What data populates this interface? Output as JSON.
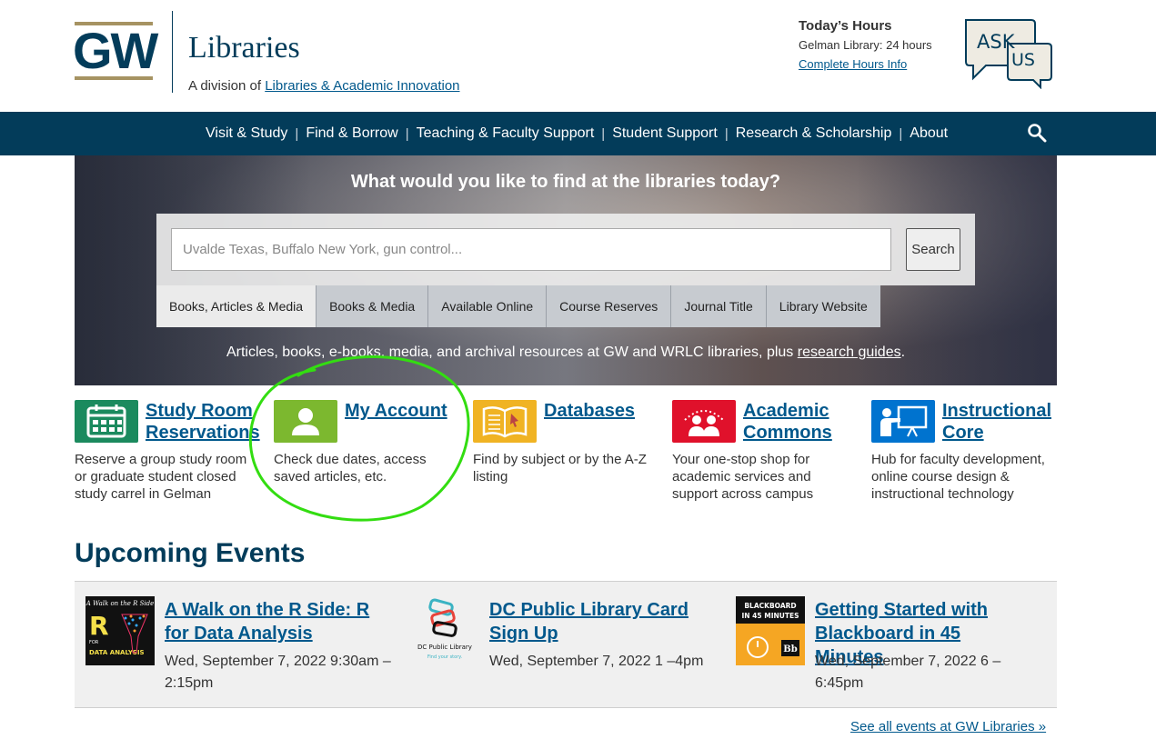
{
  "header": {
    "logo_text": "GW",
    "title": "Libraries",
    "division_prefix": "A division of",
    "division_link": "Libraries & Academic Innovation",
    "hours_title": "Today’s Hours",
    "hours_line": "Gelman Library: 24 hours",
    "hours_link": "Complete Hours Info",
    "ask_us": {
      "line1": "ASK",
      "line2": "US"
    }
  },
  "nav": {
    "items": [
      {
        "label": "Visit & Study"
      },
      {
        "label": "Find & Borrow"
      },
      {
        "label": "Teaching & Faculty Support"
      },
      {
        "label": "Student Support"
      },
      {
        "label": "Research & Scholarship"
      },
      {
        "label": "About"
      }
    ],
    "separator": "|",
    "search_icon": "search-icon"
  },
  "hero": {
    "question": "What would you like to find at the libraries today?",
    "search_placeholder": "Uvalde Texas, Buffalo New York, gun control...",
    "search_button": "Search",
    "tabs": [
      {
        "label": "Books, Articles & Media",
        "active": true
      },
      {
        "label": "Books & Media"
      },
      {
        "label": "Available Online"
      },
      {
        "label": "Course Reserves"
      },
      {
        "label": "Journal Title"
      },
      {
        "label": "Library Website"
      }
    ],
    "description_prefix": "Articles, books, e-books, media, and archival resources at GW and WRLC libraries, plus",
    "description_link": "research guides",
    "description_suffix": "."
  },
  "quick_links": [
    {
      "title": "Study Room Reservations",
      "desc": "Reserve a group study room or graduate student closed study carrel in Gelman",
      "icon": "calendar-icon",
      "color": "#1b8a5e"
    },
    {
      "title": "My Account",
      "desc": "Check due dates, access saved articles, etc.",
      "icon": "user-icon",
      "color": "#7cb82f"
    },
    {
      "title": "Databases",
      "desc": "Find by subject or by the A-Z listing",
      "icon": "book-icon",
      "color": "#f0b323"
    },
    {
      "title": "Academic Commons",
      "desc": "Your one-stop shop for academic services and support across campus",
      "icon": "group-icon",
      "color": "#e0112b"
    },
    {
      "title": "Instructional Core",
      "desc": "Hub for faculty development, online course design & instructional technology",
      "icon": "presenter-icon",
      "color": "#0073cf"
    }
  ],
  "events": {
    "title": "Upcoming Events",
    "items": [
      {
        "title": "A Walk on the R Side: R for Data Analysis",
        "date": "Wed, September 7, 2022 9:30am –2:15pm",
        "thumb_top": "A Walk on the R Side",
        "thumb_letter": "R",
        "thumb_for": "FOR",
        "thumb_sub": "DATA ANALYSIS"
      },
      {
        "title": "DC Public Library Card Sign Up",
        "date": "Wed, September 7, 2022 1 –4pm",
        "thumb_name": "DC Public Library",
        "thumb_tag": "Find your story."
      },
      {
        "title": "Getting Started with Blackboard in 45 Minutes",
        "date": "Wed, September 7, 2022 6 –6:45pm",
        "thumb_text": "BLACKBOARD IN 45 MINUTES",
        "thumb_badge": "Bb"
      }
    ],
    "see_all": "See all events at GW Libraries »"
  },
  "colors": {
    "navy": "#033c5a",
    "link": "#00588c",
    "gold": "#a69362",
    "annotation_green": "#33dd11"
  }
}
